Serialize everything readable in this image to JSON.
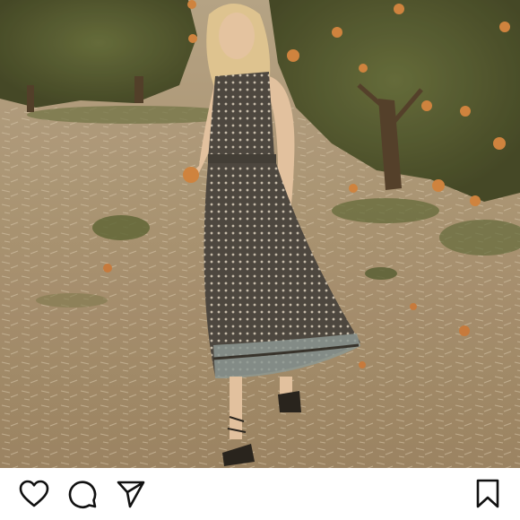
{
  "post": {
    "image": {
      "description_icon": "photo-icon"
    }
  },
  "actions": {
    "like_icon": "heart-outline-icon",
    "comment_icon": "speech-bubble-icon",
    "share_icon": "paper-plane-icon",
    "save_icon": "bookmark-outline-icon"
  },
  "colors": {
    "background": "#ffffff",
    "icon": "#111111"
  }
}
